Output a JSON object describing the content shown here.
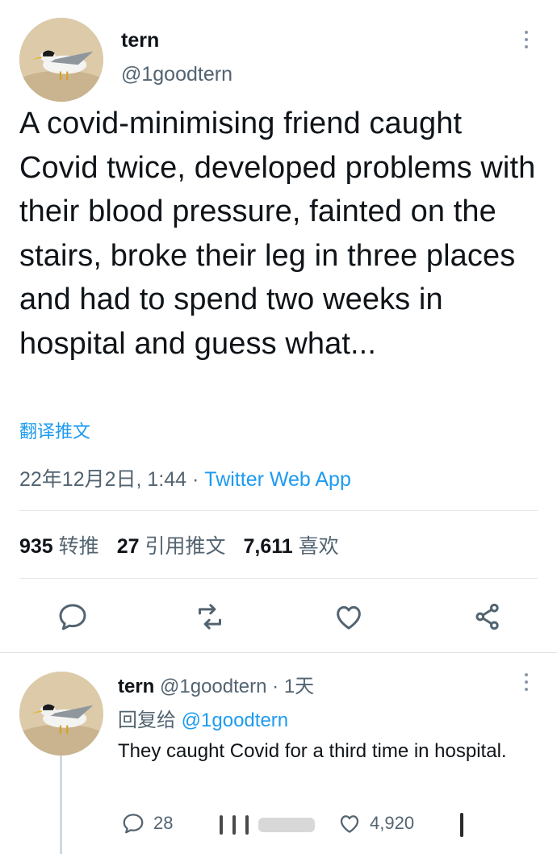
{
  "main_tweet": {
    "author_name": "tern",
    "author_handle": "@1goodtern",
    "text": "A covid-minimising friend caught Covid twice, developed problems with their blood pressure, fainted on the stairs, broke their leg in three places and had to spend two weeks in hospital and guess what...",
    "translate_label": "翻译推文",
    "timestamp": "22年12月2日, 1:44",
    "separator": " · ",
    "source": "Twitter Web App",
    "stats": {
      "retweets_count": "935",
      "retweets_label": "转推",
      "quotes_count": "27",
      "quotes_label": "引用推文",
      "likes_count": "7,611",
      "likes_label": "喜欢"
    },
    "actions": [
      "reply-icon",
      "retweet-icon",
      "like-icon",
      "share-icon"
    ]
  },
  "reply_tweet": {
    "author_name": "tern",
    "author_handle": "@1goodtern",
    "time_ago": "· 1天",
    "replying_to_label": "回复给",
    "replying_to_handle": "@1goodtern",
    "text": "They caught Covid for a third time in hospital.",
    "reply_count": "28",
    "like_count": "4,920"
  },
  "colors": {
    "accent": "#1d9bf0",
    "text": "#0f1419",
    "secondary": "#536471",
    "divider": "#e6e9eb"
  }
}
